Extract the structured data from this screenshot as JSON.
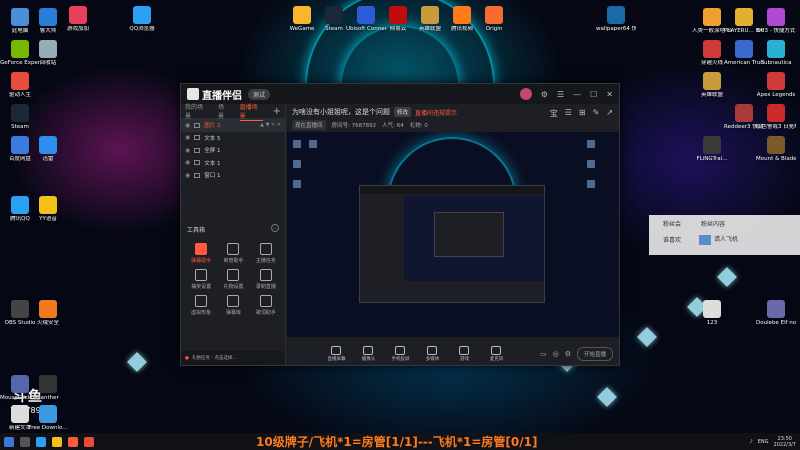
{
  "colors": {
    "accent": "#ff5a3c",
    "ticker": "#ff7a1a"
  },
  "desktop_icons_left": [
    {
      "label": "此电脑",
      "color": "#4a90d9"
    },
    {
      "label": "GeForce Experience",
      "color": "#76b900"
    },
    {
      "label": "驱动人生",
      "color": "#e94b3c"
    },
    {
      "label": "Steam",
      "color": "#1b2838"
    },
    {
      "label": "百度网盘",
      "color": "#3a7be0"
    },
    {
      "label": "腾讯QQ",
      "color": "#2aa1f3"
    },
    {
      "label": "OBS Studio",
      "color": "#444"
    },
    {
      "label": "MouseClick 快捷",
      "color": "#5566aa"
    },
    {
      "label": "新建文本",
      "color": "#ddd"
    }
  ],
  "desktop_icons_col2": [
    {
      "label": "鲁大师",
      "color": "#2a7dd6"
    },
    {
      "label": "回收站",
      "color": "#9ab"
    },
    {
      "label": "迅雷",
      "color": "#2e8ef0"
    },
    {
      "label": "YY语音",
      "color": "#f2c21a"
    },
    {
      "label": "火绒安全",
      "color": "#f27a1a"
    },
    {
      "label": "panther",
      "color": "#333"
    },
    {
      "label": "Free Downlo...",
      "color": "#3a9ae0"
    }
  ],
  "desktop_icons_top": [
    {
      "label": "游戏加加",
      "color": "#e83f5b"
    },
    {
      "label": "QQ浏览器",
      "color": "#2aa1f3"
    },
    {
      "label": "WeGame",
      "color": "#f8b62d"
    },
    {
      "label": "Steam",
      "color": "#1b2838"
    },
    {
      "label": "Ubisoft Connect",
      "color": "#2d5bd8"
    },
    {
      "label": "网易云",
      "color": "#c20c0c"
    },
    {
      "label": "英雄联盟",
      "color": "#c89b3c"
    },
    {
      "label": "腾讯视频",
      "color": "#ff7a1a"
    },
    {
      "label": "Origin",
      "color": "#f56c2d"
    },
    {
      "label": "wallpaper64 快捷方式",
      "color": "#1c69a8"
    }
  ],
  "desktop_icons_right": [
    {
      "label": "人类一败涂地 Human Fa...",
      "color": "#f0a030"
    },
    {
      "label": "PLAYERU... BATTLEGR...",
      "color": "#e0b030"
    },
    {
      "label": "BH3 - 快捷方式",
      "color": "#b04ad0"
    },
    {
      "label": "穿越火线",
      "color": "#d03a3a"
    },
    {
      "label": "American Truck Si...",
      "color": "#3a6ad0"
    },
    {
      "label": "Subnautica",
      "color": "#2ab0d0"
    },
    {
      "label": "英雄联盟",
      "color": "#c89b3c"
    },
    {
      "label": "Apex Legends",
      "color": "#d03a3a"
    },
    {
      "label": "Reddeer3 快捷方式",
      "color": "#aa3a3a"
    },
    {
      "label": "红色警戒3 日冕Mod",
      "color": "#cc2a2a"
    },
    {
      "label": "FLiNGTrai...",
      "color": "#3a3a3a"
    },
    {
      "label": "Mount & Blade II",
      "color": "#7a5a2a"
    },
    {
      "label": "Doulebe Elf no",
      "color": "#6a6aaa"
    },
    {
      "label": "123",
      "color": "#ddd"
    }
  ],
  "app": {
    "brand": "直播伴侣",
    "version": "测试",
    "left_tabs": [
      "我的场景",
      "场景",
      "直播场景"
    ],
    "active_tab": 2,
    "sources": [
      {
        "name": "图片 2",
        "selected": true
      },
      {
        "name": "文本 5",
        "selected": false
      },
      {
        "name": "全屏 1",
        "selected": false
      },
      {
        "name": "文本 1",
        "selected": false
      },
      {
        "name": "窗口 1",
        "selected": false
      }
    ],
    "tools_title": "工具箱",
    "tools": [
      {
        "label": "弹幕助手",
        "on": true
      },
      {
        "label": "房管助手",
        "on": false
      },
      {
        "label": "主播任务",
        "on": false
      },
      {
        "label": "抽奖设置",
        "on": false
      },
      {
        "label": "礼物设置",
        "on": false
      },
      {
        "label": "录制直播",
        "on": false
      },
      {
        "label": "虚拟形象",
        "on": false
      },
      {
        "label": "弹幕库",
        "on": false
      },
      {
        "label": "歌词助手",
        "on": false
      }
    ],
    "status_line": "礼物任务 - 点击选择...",
    "title_line": "为啥没有小姐姐呢，这是个问题",
    "title_chip": "修改",
    "title_warn": "直播间违规提示",
    "sub_items": [
      "现在直播间",
      "房间号: 7687892",
      "人气: 64",
      "礼物: 0"
    ],
    "top_actions": [
      "宝",
      "☰",
      "⊞",
      "✎",
      "↗"
    ],
    "bottom_buttons": [
      "直播屏幕",
      "摄像头",
      "手机投屏",
      "多媒体",
      "游戏",
      "麦克风"
    ],
    "start_label": "开始直播"
  },
  "panel": {
    "headers": [
      "粉丝会",
      "粉丝内容"
    ],
    "items": [
      "谁喜欢",
      "请人飞机"
    ]
  },
  "watermark": {
    "logo": "斗鱼",
    "room_id": "7687892"
  },
  "ticker": "10级牌子/飞机*1=房管[1/1]---飞机*1=房管[0/1]",
  "taskbar": {
    "lang": "ENG",
    "time": "23:50",
    "date": "2022/3/7"
  }
}
